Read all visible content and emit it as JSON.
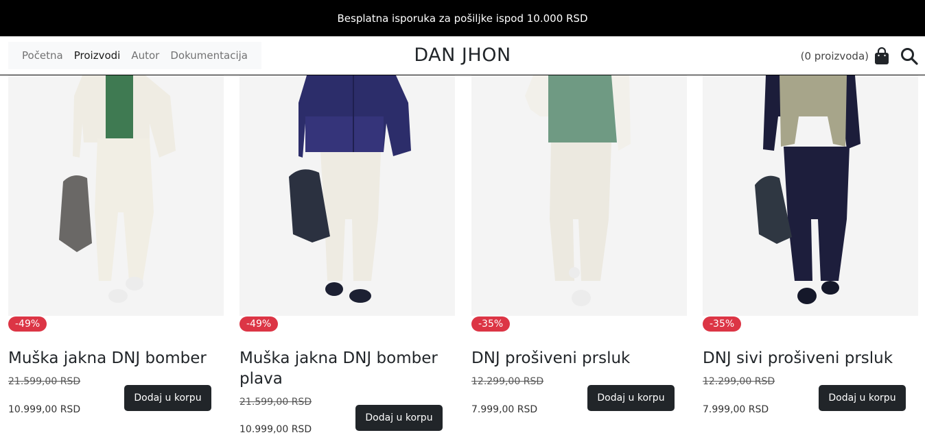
{
  "announcement": "Besplatna isporuka za pošiljke ispod 10.000 RSD",
  "nav": {
    "links": [
      "Početna",
      "Proizvodi",
      "Autor",
      "Dokumentacija"
    ],
    "active": "Proizvodi"
  },
  "brand": "DAN JHON",
  "cart": {
    "count_label": "(0 proizvoda)",
    "icon": "shopping-bag-icon"
  },
  "search": {
    "icon": "search-icon"
  },
  "products": [
    {
      "discount": "-49%",
      "title": "Muška jakna DNJ bomber",
      "old_price": "21.599,00 RSD",
      "new_price": "10.999,00 RSD",
      "button": "Dodaj u korpu",
      "jacket_color": "#efece3",
      "inner_color": "#3f7a52",
      "pants_color": "#f1eee4",
      "bag_color": "#6a6866",
      "shoe_color": "#ececec"
    },
    {
      "discount": "-49%",
      "title": "Muška jakna DNJ bomber plava",
      "old_price": "21.599,00 RSD",
      "new_price": "10.999,00 RSD",
      "button": "Dodaj u korpu",
      "jacket_color": "#2c2d6a",
      "inner_color": "#35347a",
      "pants_color": "#eeebe2",
      "bag_color": "#2b3140",
      "shoe_color": "#1c2033"
    },
    {
      "discount": "-35%",
      "title": "DNJ prošiveni prsluk",
      "old_price": "12.299,00 RSD",
      "new_price": "7.999,00 RSD",
      "button": "Dodaj u korpu",
      "jacket_color": "#f2f0ea",
      "inner_color": "#6f9a83",
      "pants_color": "#ece9e0",
      "bag_color": "#6f9a83",
      "shoe_color": "#ececec"
    },
    {
      "discount": "-35%",
      "title": "DNJ sivi prošiveni prsluk",
      "old_price": "12.299,00 RSD",
      "new_price": "7.999,00 RSD",
      "button": "Dodaj u korpu",
      "jacket_color": "#1c1d3a",
      "inner_color": "#a7a58a",
      "pants_color": "#1d1e3c",
      "bag_color": "#2f3742",
      "shoe_color": "#15182a"
    }
  ]
}
